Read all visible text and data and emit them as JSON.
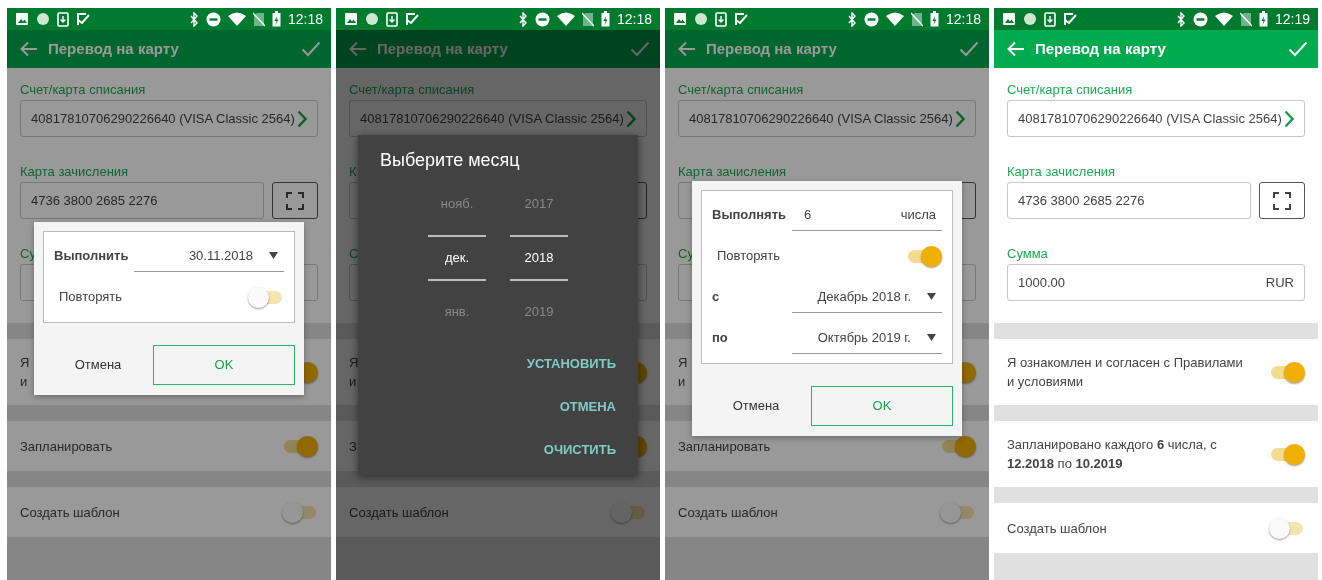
{
  "screens": [
    {
      "status_bar": {
        "time": "12:18"
      },
      "app_bar": {
        "title": "Перевод на карту"
      },
      "form": {
        "source": {
          "label": "Счет/карта списания",
          "value": "40817810706290226640 (VISA Classic 2564)"
        },
        "dest": {
          "label": "Карта зачисления",
          "value": "4736 3800 2685 2276"
        },
        "amount": {
          "label": "Су"
        }
      },
      "toggles": [
        {
          "lines": [
            "Я",
            "и"
          ],
          "on": true
        },
        {
          "lines": [
            "Запланировать"
          ],
          "on": true
        },
        {
          "lines": [
            "Создать шаблон"
          ],
          "on": false
        }
      ],
      "dialog": {
        "kind": "schedule",
        "rows": [
          {
            "kind": "dropdown",
            "label": "Выполнить",
            "value": "30.11.2018"
          },
          {
            "kind": "switch",
            "label": "Повторять",
            "on": false
          }
        ],
        "buttons": [
          {
            "label": "Отмена",
            "primary": false
          },
          {
            "label": "OK",
            "primary": true
          }
        ]
      }
    },
    {
      "status_bar": {
        "time": "12:18"
      },
      "app_bar": {
        "title": "Перевод на карту"
      },
      "form": {
        "source": {
          "label": "Счет/карта списания",
          "value": "40817810706290226640 (VISA Classic 2564)"
        },
        "dest": {
          "label": "К"
        },
        "amount": {
          "label": "С"
        }
      },
      "toggles": [
        {
          "lines": [
            "Я",
            "и"
          ],
          "on": true
        },
        {
          "lines": [
            "З"
          ],
          "on": true
        },
        {
          "lines": [
            "Создать шаблон"
          ],
          "on": false
        }
      ],
      "dialog": {
        "kind": "month_picker",
        "title": "Выберите месяц",
        "columns": [
          {
            "items": [
              {
                "label": "нояб.",
                "selected": false
              },
              {
                "label": "дек.",
                "selected": true
              },
              {
                "label": "янв.",
                "selected": false
              }
            ]
          },
          {
            "items": [
              {
                "label": "2017",
                "selected": false
              },
              {
                "label": "2018",
                "selected": true
              },
              {
                "label": "2019",
                "selected": false
              }
            ]
          }
        ],
        "buttons": [
          {
            "label": "УСТАНОВИТЬ"
          },
          {
            "label": "ОТМЕНА"
          },
          {
            "label": "ОЧИСТИТЬ"
          }
        ]
      }
    },
    {
      "status_bar": {
        "time": "12:18"
      },
      "app_bar": {
        "title": "Перевод на карту"
      },
      "form": {
        "source": {
          "label": "Счет/карта списания",
          "value": "40817810706290226640 (VISA Classic 2564)"
        },
        "dest": {
          "label": "Карта зачисления"
        },
        "amount": {
          "label": "Су"
        }
      },
      "toggles": [
        {
          "lines": [
            "Я",
            "и"
          ],
          "on": true
        },
        {
          "lines": [
            "Запланировать"
          ],
          "on": true
        },
        {
          "lines": [
            "Создать шаблон"
          ],
          "on": false
        }
      ],
      "dialog": {
        "kind": "schedule",
        "rows": [
          {
            "kind": "number",
            "label": "Выполнять",
            "value": "6",
            "suffix": "числа"
          },
          {
            "kind": "switch",
            "label": "Повторять",
            "on": true
          },
          {
            "kind": "dropdown",
            "label": "с",
            "value": "Декабрь 2018 г."
          },
          {
            "kind": "dropdown",
            "label": "по",
            "value": "Октябрь 2019 г."
          }
        ],
        "buttons": [
          {
            "label": "Отмена",
            "primary": false
          },
          {
            "label": "OK",
            "primary": true
          }
        ]
      }
    },
    {
      "status_bar": {
        "time": "12:19"
      },
      "app_bar": {
        "title": "Перевод на карту"
      },
      "form": {
        "source": {
          "label": "Счет/карта списания",
          "value": "40817810706290226640 (VISA Classic 2564)"
        },
        "dest": {
          "label": "Карта зачисления",
          "value": "4736 3800 2685 2276"
        },
        "amount": {
          "label": "Сумма",
          "value": "1000.00",
          "currency": "RUR"
        }
      },
      "toggles": [
        {
          "lines": [
            "Я ознакомлен и согласен с Правилами и условиями"
          ],
          "on": true
        },
        {
          "lines": [
            "Запланировано каждого **6** числа, с **12.2018** по **10.2019**"
          ],
          "on": true
        },
        {
          "lines": [
            "Создать шаблон"
          ],
          "on": false
        }
      ]
    }
  ]
}
